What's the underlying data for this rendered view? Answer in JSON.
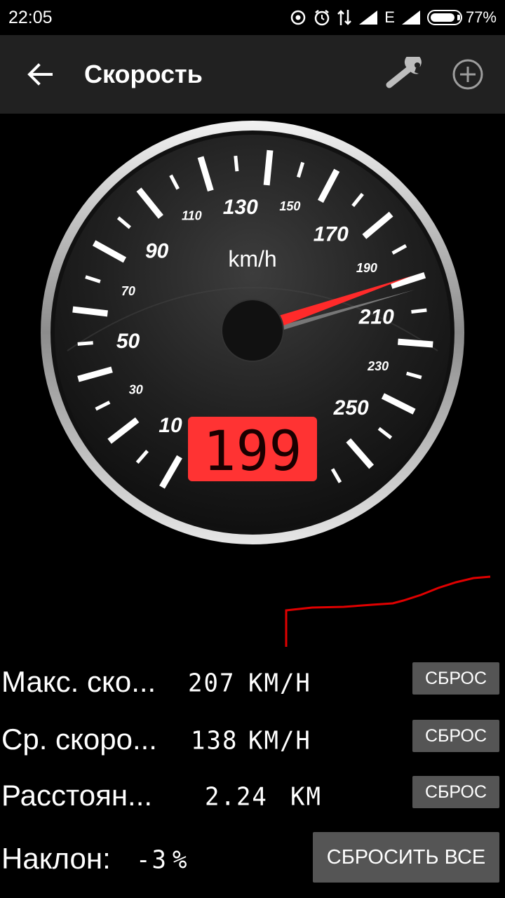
{
  "status_bar": {
    "time": "22:05",
    "network": "E",
    "battery": "77%"
  },
  "app_bar": {
    "title": "Скорость",
    "icons": {
      "back": "arrow-back-icon",
      "settings": "wrench-icon",
      "add": "add-circle-icon"
    }
  },
  "speedometer": {
    "unit": "km/h",
    "current_speed": 199,
    "display": "199",
    "min": 0,
    "max": 270,
    "major_labels": [
      "10",
      "30",
      "50",
      "70",
      "90",
      "110",
      "130",
      "150",
      "170",
      "190",
      "210",
      "230",
      "250"
    ],
    "colors": {
      "needle": "#ff2a2a",
      "display_bg": "#ff3333",
      "face": "#1a1a1a",
      "rim": "#d0d0d0"
    }
  },
  "graph": {
    "line_color": "#e00000"
  },
  "stats": {
    "max_speed": {
      "label": "Макс. ско...",
      "value": "207",
      "unit": "KM/H",
      "button": "СБРОС"
    },
    "avg_speed": {
      "label": "Ср. скоро...",
      "value": "138",
      "unit": "KM/H",
      "button": "СБРОС"
    },
    "distance": {
      "label": "Расстоян...",
      "value": "2.24",
      "unit": "KM",
      "button": "СБРОС"
    },
    "incline": {
      "label": "Наклон:",
      "value": "-3",
      "unit": "%"
    },
    "reset_all": "СБРОСИТЬ ВСЕ"
  }
}
